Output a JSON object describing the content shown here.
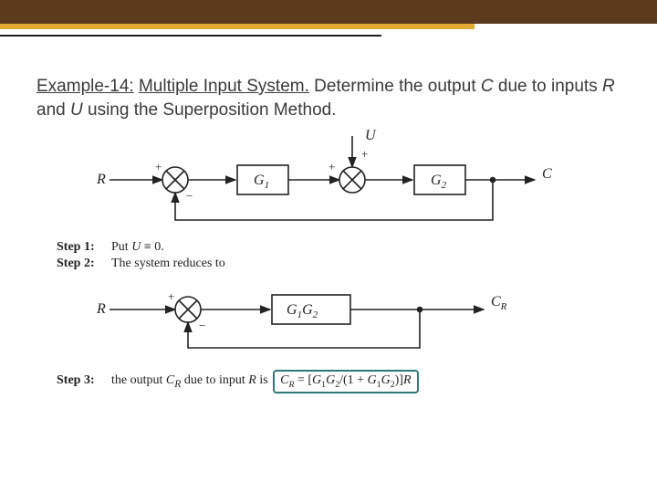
{
  "header": {
    "example_label": "Example-14:",
    "title_underlined": "Multiple Input System.",
    "body_before_c": "Determine the output ",
    "c": "C",
    "body_mid": " due to inputs ",
    "r": "R",
    "and": " and ",
    "u": "U",
    "body_after": " using the Superposition Method."
  },
  "diagram1": {
    "R": "R",
    "U": "U",
    "C": "C",
    "G1": "G1",
    "G2": "G2",
    "plus": "+",
    "minus": "−"
  },
  "steps12": {
    "step1_label": "Step 1:",
    "step1_text_a": "Put ",
    "step1_text_b": "U",
    "step1_text_c": " ≡ 0.",
    "step2_label": "Step 2:",
    "step2_text": "The system reduces to"
  },
  "diagram2": {
    "R": "R",
    "CR": "C",
    "CR_sub": "R",
    "G1G2": "G1G2",
    "plus": "+",
    "minus": "−"
  },
  "step3": {
    "label": "Step 3:",
    "text_a": "the output ",
    "text_b": "C",
    "text_b_sub": "R",
    "text_c": " due to input ",
    "text_d": "R",
    "text_e": " is ",
    "formula": "CR = [G1G2 / (1 + G1G2)] R"
  }
}
